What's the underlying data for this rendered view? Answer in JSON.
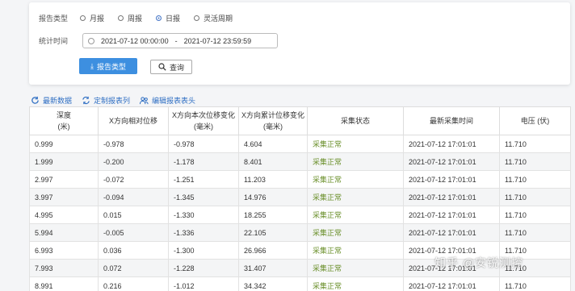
{
  "filter": {
    "report_type_label": "报告类型",
    "options": [
      {
        "label": "月报",
        "selected": false
      },
      {
        "label": "周报",
        "selected": false
      },
      {
        "label": "日报",
        "selected": true
      },
      {
        "label": "灵活周期",
        "selected": false
      }
    ],
    "stat_time_label": "统计时间",
    "range_start": "2021-07-12 00:00:00",
    "range_sep": "-",
    "range_end": "2021-07-12 23:59:59",
    "report_button": "报告类型",
    "search_button": "查询"
  },
  "toolbar": {
    "refresh": "最新数据",
    "customize": "定制报表列",
    "edit_header": "编辑报表表头"
  },
  "table": {
    "headers": [
      [
        "深度",
        "(米)"
      ],
      [
        "X方向相对位移"
      ],
      [
        "X方向本次位移变化",
        "(毫米)"
      ],
      [
        "X方向累计位移变化",
        "(毫米)"
      ],
      [
        "采集状态"
      ],
      [
        "最新采集时间"
      ],
      [
        "电压 (伏)"
      ]
    ],
    "rows": [
      [
        "0.999",
        "-0.978",
        "-0.978",
        "4.604",
        "采集正常",
        "2021-07-12 17:01:01",
        "11.710"
      ],
      [
        "1.999",
        "-0.200",
        "-1.178",
        "8.401",
        "采集正常",
        "2021-07-12 17:01:01",
        "11.710"
      ],
      [
        "2.997",
        "-0.072",
        "-1.251",
        "11.203",
        "采集正常",
        "2021-07-12 17:01:01",
        "11.710"
      ],
      [
        "3.997",
        "-0.094",
        "-1.345",
        "14.976",
        "采集正常",
        "2021-07-12 17:01:01",
        "11.710"
      ],
      [
        "4.995",
        "0.015",
        "-1.330",
        "18.255",
        "采集正常",
        "2021-07-12 17:01:01",
        "11.710"
      ],
      [
        "5.994",
        "-0.005",
        "-1.336",
        "22.105",
        "采集正常",
        "2021-07-12 17:01:01",
        "11.710"
      ],
      [
        "6.993",
        "0.036",
        "-1.300",
        "26.966",
        "采集正常",
        "2021-07-12 17:01:01",
        "11.710"
      ],
      [
        "7.993",
        "0.072",
        "-1.228",
        "31.407",
        "采集正常",
        "2021-07-12 17:01:01",
        "11.710"
      ],
      [
        "8.991",
        "0.216",
        "-1.012",
        "34.342",
        "采集正常",
        "2021-07-12 17:01:01",
        "11.710"
      ]
    ]
  },
  "watermark": "知乎 @安锐测控",
  "colors": {
    "accent": "#3d8fe0",
    "link": "#2f6fc3",
    "status_ok": "#6a8f2a"
  }
}
